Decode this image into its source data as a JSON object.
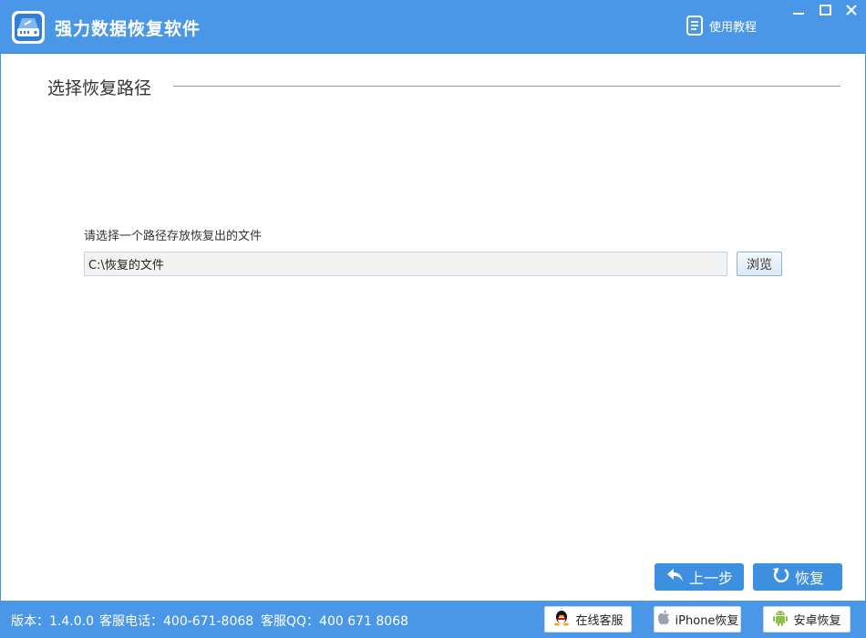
{
  "window": {
    "title": "强力数据恢复软件",
    "tutorial_label": "使用教程",
    "minimize_icon": "minimize-icon",
    "maximize_icon": "maximize-icon",
    "close_icon": "close-icon"
  },
  "section": {
    "title": "选择恢复路径"
  },
  "path": {
    "prompt": "请选择一个路径存放恢复出的文件",
    "value": "C:\\恢复的文件",
    "browse_label": "浏览"
  },
  "nav": {
    "prev_label": "上一步",
    "recover_label": "恢复"
  },
  "status": {
    "version": "版本：1.4.0.0",
    "phone": "客服电话：400-671-8068",
    "qq": "客服QQ：400 671 8068"
  },
  "footer_buttons": {
    "online_service": "在线客服",
    "iphone_recover": "iPhone恢复",
    "android_recover": "安卓恢复"
  },
  "colors": {
    "brand": "#4a97e8",
    "button": "#3d8fe0"
  }
}
